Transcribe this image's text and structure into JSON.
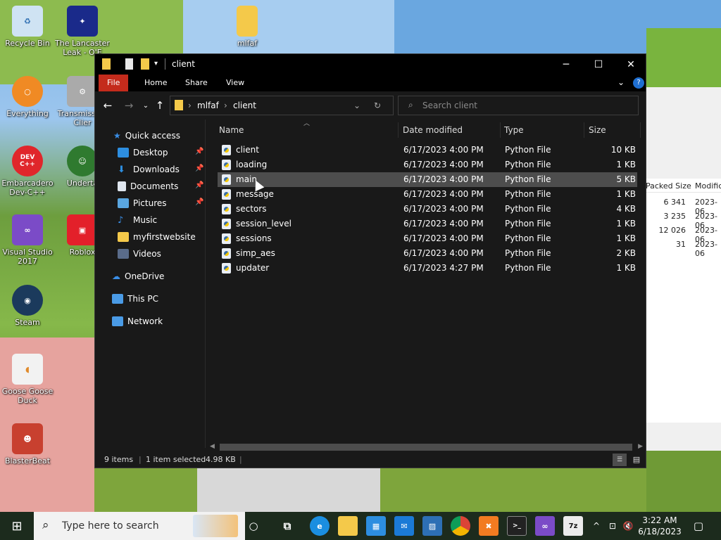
{
  "desktop": {
    "icons": [
      {
        "label": "Recycle Bin",
        "icon": "recycle-bin-icon"
      },
      {
        "label": "The Lancaster Leak - O'E",
        "icon": "shortcut-icon"
      },
      {
        "label": "mlfaf",
        "icon": "folder-icon"
      },
      {
        "label": "Everything",
        "icon": "everything-icon"
      },
      {
        "label": "Transmiss Qt Clier",
        "icon": "transmission-icon"
      },
      {
        "label": "Embarcadero Dev-C++",
        "icon": "devcpp-icon",
        "badge": "DEV C++"
      },
      {
        "label": "Underta",
        "icon": "undertale-icon"
      },
      {
        "label": "Visual Studio 2017",
        "icon": "visual-studio-icon"
      },
      {
        "label": "Roblox",
        "icon": "roblox-icon"
      },
      {
        "label": "Steam",
        "icon": "steam-icon"
      },
      {
        "label": "Goose Goose Duck",
        "icon": "goose-icon"
      },
      {
        "label": "BlasterBeat",
        "icon": "blasterbeat-icon"
      }
    ]
  },
  "background_window": {
    "columns": [
      "Packed Size",
      "Modific"
    ],
    "rows": [
      {
        "size": "6 341",
        "date": "2023-06"
      },
      {
        "size": "3 235",
        "date": "2023-06"
      },
      {
        "size": "12 026",
        "date": "2023-06"
      },
      {
        "size": "31",
        "date": "2023-06"
      }
    ]
  },
  "explorer": {
    "title": "client",
    "ribbon_tabs": [
      "File",
      "Home",
      "Share",
      "View"
    ],
    "breadcrumb": [
      "mlfaf",
      "client"
    ],
    "search_placeholder": "Search client",
    "sidebar": [
      {
        "label": "Quick access",
        "icon": "star-icon",
        "pinned": false
      },
      {
        "label": "Desktop",
        "icon": "desktop-icon",
        "pinned": true
      },
      {
        "label": "Downloads",
        "icon": "download-icon",
        "pinned": true
      },
      {
        "label": "Documents",
        "icon": "documents-icon",
        "pinned": true
      },
      {
        "label": "Pictures",
        "icon": "pictures-icon",
        "pinned": true
      },
      {
        "label": "Music",
        "icon": "music-icon",
        "pinned": false
      },
      {
        "label": "myfirstwebsite",
        "icon": "folder-icon",
        "pinned": false
      },
      {
        "label": "Videos",
        "icon": "videos-icon",
        "pinned": false
      },
      {
        "label": "OneDrive",
        "icon": "cloud-icon",
        "pinned": false
      },
      {
        "label": "This PC",
        "icon": "computer-icon",
        "pinned": false
      },
      {
        "label": "Network",
        "icon": "network-icon",
        "pinned": false
      }
    ],
    "columns": [
      "Name",
      "Date modified",
      "Type",
      "Size"
    ],
    "files": [
      {
        "name": "client",
        "date": "6/17/2023 4:00 PM",
        "type": "Python File",
        "size": "10 KB"
      },
      {
        "name": "loading",
        "date": "6/17/2023 4:00 PM",
        "type": "Python File",
        "size": "1 KB"
      },
      {
        "name": "main",
        "date": "6/17/2023 4:00 PM",
        "type": "Python File",
        "size": "5 KB"
      },
      {
        "name": "message",
        "date": "6/17/2023 4:00 PM",
        "type": "Python File",
        "size": "1 KB"
      },
      {
        "name": "sectors",
        "date": "6/17/2023 4:00 PM",
        "type": "Python File",
        "size": "4 KB"
      },
      {
        "name": "session_level",
        "date": "6/17/2023 4:00 PM",
        "type": "Python File",
        "size": "1 KB"
      },
      {
        "name": "sessions",
        "date": "6/17/2023 4:00 PM",
        "type": "Python File",
        "size": "1 KB"
      },
      {
        "name": "simp_aes",
        "date": "6/17/2023 4:00 PM",
        "type": "Python File",
        "size": "2 KB"
      },
      {
        "name": "updater",
        "date": "6/17/2023 4:27 PM",
        "type": "Python File",
        "size": "1 KB"
      }
    ],
    "selected_file": "main",
    "status": {
      "item_count": "9 items",
      "selection": "1 item selected",
      "selection_size": "4.98 KB"
    }
  },
  "taskbar": {
    "search_placeholder": "Type here to search",
    "apps": [
      "task-view-icon",
      "edge-icon",
      "file-explorer-icon",
      "store-icon",
      "mail-icon",
      "photos-icon",
      "chrome-icon",
      "xampp-icon",
      "terminal-icon",
      "visual-studio-icon",
      "7zip-icon"
    ],
    "time": "3:22 AM",
    "date": "6/18/2023"
  },
  "colors": {
    "accent_file_tab": "#c42b1c",
    "selected_row": "#4d4d4d",
    "window_bg": "#191919"
  }
}
